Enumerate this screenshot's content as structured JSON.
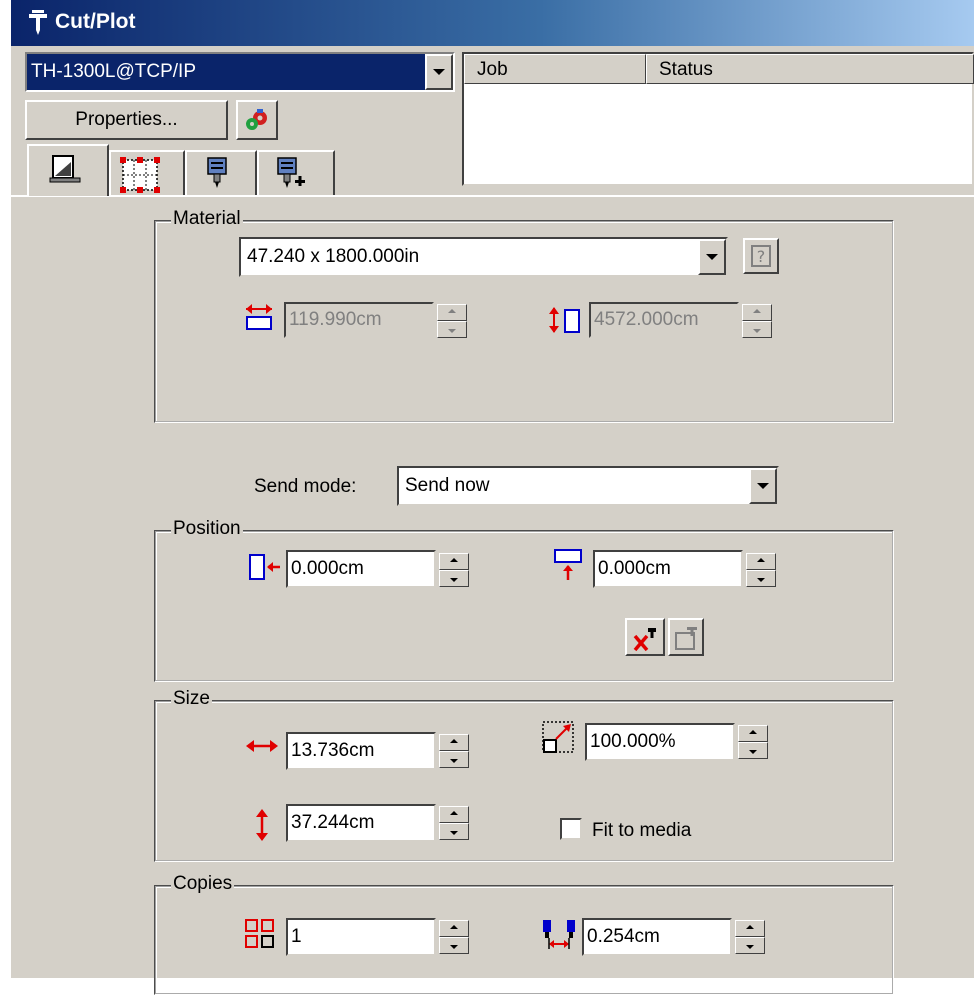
{
  "window": {
    "title": "Cut/Plot"
  },
  "device": {
    "selected": "TH-1300L@TCP/IP"
  },
  "buttons": {
    "properties": "Properties..."
  },
  "tabs": [
    "page-setup-icon",
    "layout-grid-icon",
    "cutter-tool-icon",
    "cutter-tool-add-icon"
  ],
  "jobs": {
    "columns": [
      "Job",
      "Status"
    ],
    "rows": []
  },
  "material": {
    "legend": "Material",
    "selected": "47.240 x 1800.000in",
    "width": "119.990cm",
    "length": "4572.000cm"
  },
  "send_mode": {
    "label": "Send mode:",
    "value": "Send now"
  },
  "position": {
    "legend": "Position",
    "x": "0.000cm",
    "y": "0.000cm"
  },
  "size": {
    "legend": "Size",
    "width": "13.736cm",
    "height": "37.244cm",
    "scale": "100.000%",
    "fit_label": "Fit to media",
    "fit_checked": false
  },
  "copies": {
    "legend": "Copies",
    "count": "1",
    "spacing": "0.254cm"
  },
  "colors": {
    "title_start": "#0a246a",
    "title_end": "#a6caf0",
    "face": "#d4d0c8",
    "icon_red": "#e00000",
    "icon_blue": "#0000cc"
  }
}
